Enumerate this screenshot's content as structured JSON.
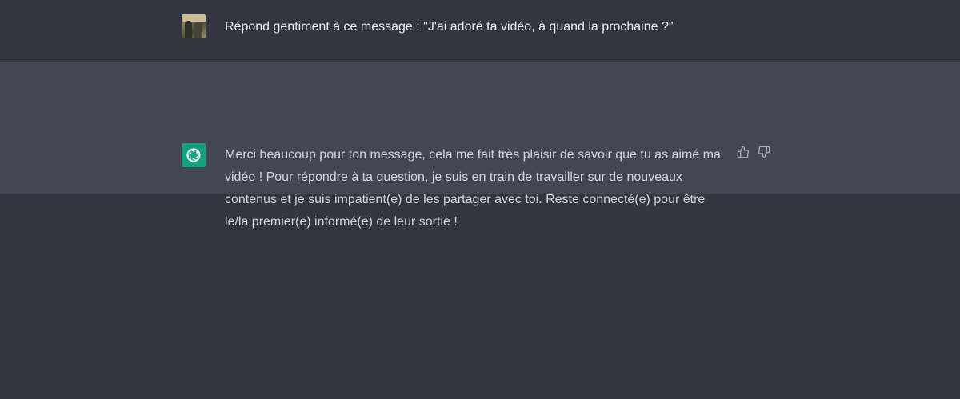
{
  "conversation": {
    "user_message": {
      "avatar_icon": "user-photo-avatar",
      "text": "Répond gentiment à ce message : \"J'ai adoré ta vidéo, à quand la prochaine ?\""
    },
    "assistant_message": {
      "avatar_icon": "openai-logo-icon",
      "text": "Merci beaucoup pour ton message, cela me fait très plaisir de savoir que tu as aimé ma vidéo ! Pour répondre à ta question, je suis en train de travailler sur de nouveaux contenus et je suis impatient(e) de les partager avec toi. Reste connecté(e) pour être le/la premier(e) informé(e) de leur sortie !",
      "feedback_icons": [
        "thumbs-up-icon",
        "thumbs-down-icon"
      ]
    }
  },
  "colors": {
    "background": "#343541",
    "assistant_background": "#444654",
    "assistant_avatar": "#10a37f",
    "user_text": "#ececf1",
    "assistant_text": "#d1d5db"
  }
}
